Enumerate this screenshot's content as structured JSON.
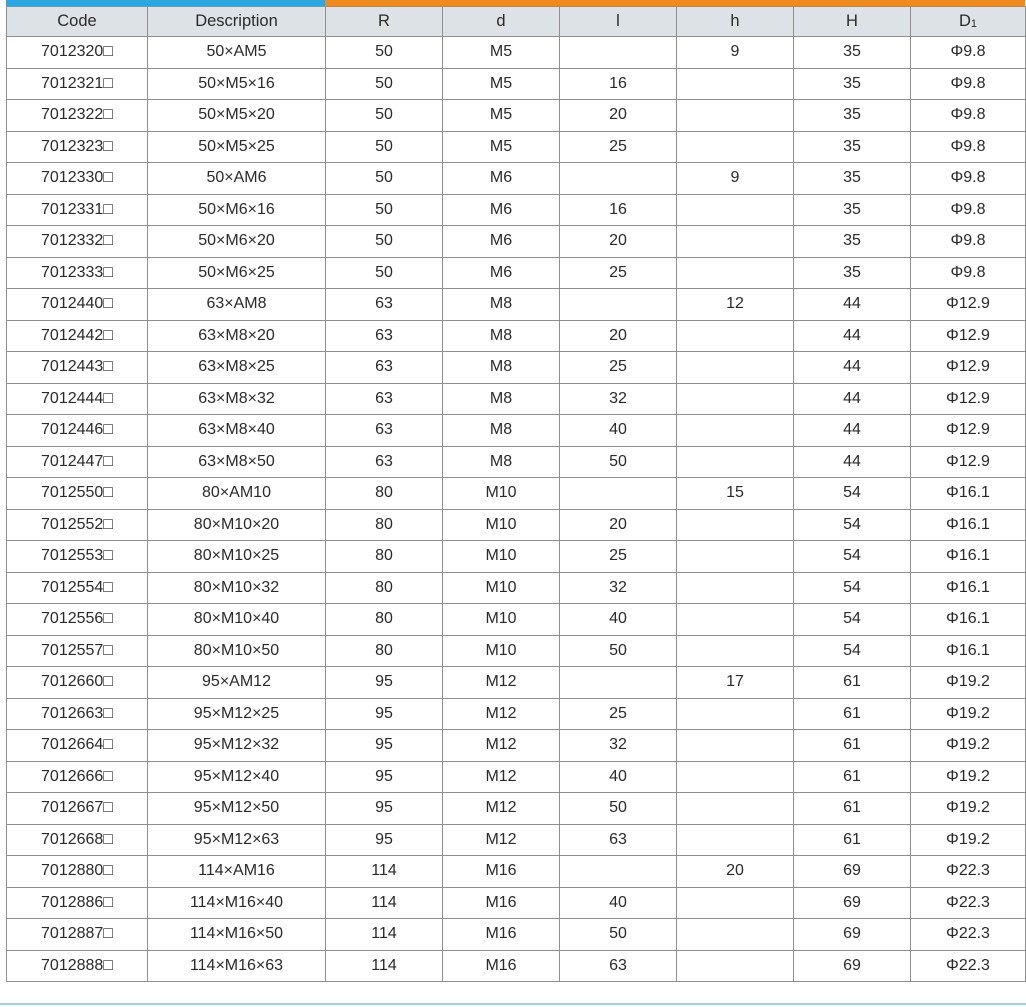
{
  "header": {
    "code": "Code",
    "description": "Description",
    "R": "R",
    "d": "d",
    "l": "l",
    "h": "h",
    "H": "H",
    "D_main": "D",
    "D_sub": "1"
  },
  "colors": {
    "accent_blue": "#29a7e1",
    "accent_orange": "#ef8a1f",
    "header_bg": "#dde2e6",
    "grid_line": "#8f8f8f"
  },
  "rows": [
    {
      "code": "7012320□",
      "description": "50×AM5",
      "R": "50",
      "d": "M5",
      "l": "",
      "h": "9",
      "H": "35",
      "D1": "Φ9.8"
    },
    {
      "code": "7012321□",
      "description": "50×M5×16",
      "R": "50",
      "d": "M5",
      "l": "16",
      "h": "",
      "H": "35",
      "D1": "Φ9.8"
    },
    {
      "code": "7012322□",
      "description": "50×M5×20",
      "R": "50",
      "d": "M5",
      "l": "20",
      "h": "",
      "H": "35",
      "D1": "Φ9.8"
    },
    {
      "code": "7012323□",
      "description": "50×M5×25",
      "R": "50",
      "d": "M5",
      "l": "25",
      "h": "",
      "H": "35",
      "D1": "Φ9.8"
    },
    {
      "code": "7012330□",
      "description": "50×AM6",
      "R": "50",
      "d": "M6",
      "l": "",
      "h": "9",
      "H": "35",
      "D1": "Φ9.8"
    },
    {
      "code": "7012331□",
      "description": "50×M6×16",
      "R": "50",
      "d": "M6",
      "l": "16",
      "h": "",
      "H": "35",
      "D1": "Φ9.8"
    },
    {
      "code": "7012332□",
      "description": "50×M6×20",
      "R": "50",
      "d": "M6",
      "l": "20",
      "h": "",
      "H": "35",
      "D1": "Φ9.8"
    },
    {
      "code": "7012333□",
      "description": "50×M6×25",
      "R": "50",
      "d": "M6",
      "l": "25",
      "h": "",
      "H": "35",
      "D1": "Φ9.8"
    },
    {
      "code": "7012440□",
      "description": "63×AM8",
      "R": "63",
      "d": "M8",
      "l": "",
      "h": "12",
      "H": "44",
      "D1": "Φ12.9"
    },
    {
      "code": "7012442□",
      "description": "63×M8×20",
      "R": "63",
      "d": "M8",
      "l": "20",
      "h": "",
      "H": "44",
      "D1": "Φ12.9"
    },
    {
      "code": "7012443□",
      "description": "63×M8×25",
      "R": "63",
      "d": "M8",
      "l": "25",
      "h": "",
      "H": "44",
      "D1": "Φ12.9"
    },
    {
      "code": "7012444□",
      "description": "63×M8×32",
      "R": "63",
      "d": "M8",
      "l": "32",
      "h": "",
      "H": "44",
      "D1": "Φ12.9"
    },
    {
      "code": "7012446□",
      "description": "63×M8×40",
      "R": "63",
      "d": "M8",
      "l": "40",
      "h": "",
      "H": "44",
      "D1": "Φ12.9"
    },
    {
      "code": "7012447□",
      "description": "63×M8×50",
      "R": "63",
      "d": "M8",
      "l": "50",
      "h": "",
      "H": "44",
      "D1": "Φ12.9"
    },
    {
      "code": "7012550□",
      "description": "80×AM10",
      "R": "80",
      "d": "M10",
      "l": "",
      "h": "15",
      "H": "54",
      "D1": "Φ16.1"
    },
    {
      "code": "7012552□",
      "description": "80×M10×20",
      "R": "80",
      "d": "M10",
      "l": "20",
      "h": "",
      "H": "54",
      "D1": "Φ16.1"
    },
    {
      "code": "7012553□",
      "description": "80×M10×25",
      "R": "80",
      "d": "M10",
      "l": "25",
      "h": "",
      "H": "54",
      "D1": "Φ16.1"
    },
    {
      "code": "7012554□",
      "description": "80×M10×32",
      "R": "80",
      "d": "M10",
      "l": "32",
      "h": "",
      "H": "54",
      "D1": "Φ16.1"
    },
    {
      "code": "7012556□",
      "description": "80×M10×40",
      "R": "80",
      "d": "M10",
      "l": "40",
      "h": "",
      "H": "54",
      "D1": "Φ16.1"
    },
    {
      "code": "7012557□",
      "description": "80×M10×50",
      "R": "80",
      "d": "M10",
      "l": "50",
      "h": "",
      "H": "54",
      "D1": "Φ16.1"
    },
    {
      "code": "7012660□",
      "description": "95×AM12",
      "R": "95",
      "d": "M12",
      "l": "",
      "h": "17",
      "H": "61",
      "D1": "Φ19.2"
    },
    {
      "code": "7012663□",
      "description": "95×M12×25",
      "R": "95",
      "d": "M12",
      "l": "25",
      "h": "",
      "H": "61",
      "D1": "Φ19.2"
    },
    {
      "code": "7012664□",
      "description": "95×M12×32",
      "R": "95",
      "d": "M12",
      "l": "32",
      "h": "",
      "H": "61",
      "D1": "Φ19.2"
    },
    {
      "code": "7012666□",
      "description": "95×M12×40",
      "R": "95",
      "d": "M12",
      "l": "40",
      "h": "",
      "H": "61",
      "D1": "Φ19.2"
    },
    {
      "code": "7012667□",
      "description": "95×M12×50",
      "R": "95",
      "d": "M12",
      "l": "50",
      "h": "",
      "H": "61",
      "D1": "Φ19.2"
    },
    {
      "code": "7012668□",
      "description": "95×M12×63",
      "R": "95",
      "d": "M12",
      "l": "63",
      "h": "",
      "H": "61",
      "D1": "Φ19.2"
    },
    {
      "code": "7012880□",
      "description": "114×AM16",
      "R": "114",
      "d": "M16",
      "l": "",
      "h": "20",
      "H": "69",
      "D1": "Φ22.3"
    },
    {
      "code": "7012886□",
      "description": "114×M16×40",
      "R": "114",
      "d": "M16",
      "l": "40",
      "h": "",
      "H": "69",
      "D1": "Φ22.3"
    },
    {
      "code": "7012887□",
      "description": "114×M16×50",
      "R": "114",
      "d": "M16",
      "l": "50",
      "h": "",
      "H": "69",
      "D1": "Φ22.3"
    },
    {
      "code": "7012888□",
      "description": "114×M16×63",
      "R": "114",
      "d": "M16",
      "l": "63",
      "h": "",
      "H": "69",
      "D1": "Φ22.3"
    }
  ]
}
